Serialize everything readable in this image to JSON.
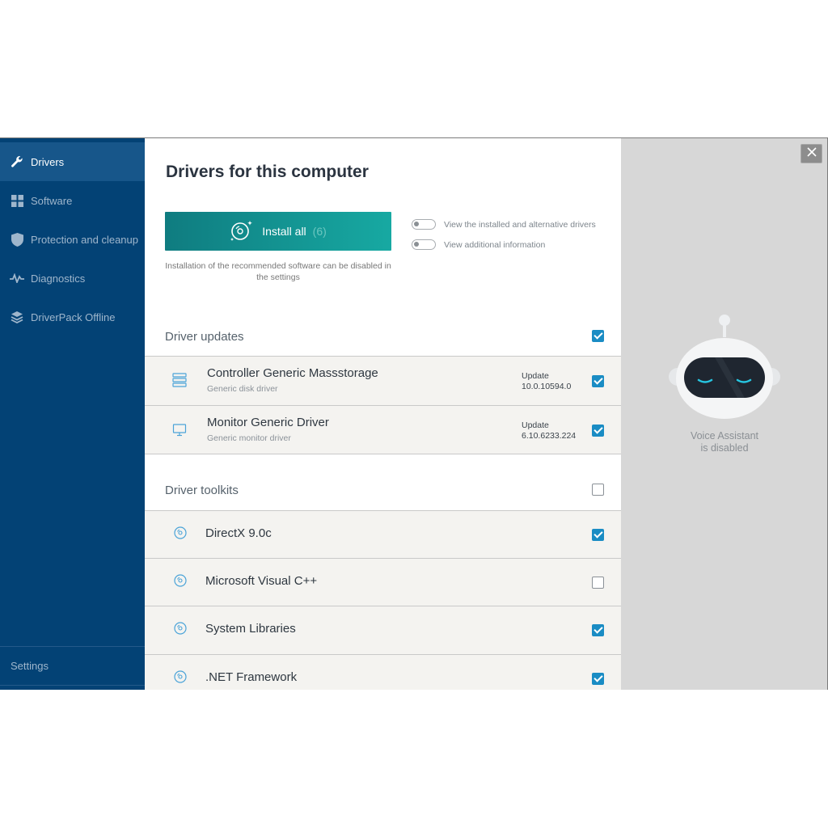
{
  "sidebar": {
    "items": [
      {
        "label": "Drivers",
        "icon": "wrench-icon",
        "active": true
      },
      {
        "label": "Software",
        "icon": "grid-icon",
        "active": false
      },
      {
        "label": "Protection and cleanup",
        "icon": "shield-icon",
        "active": false
      },
      {
        "label": "Diagnostics",
        "icon": "pulse-icon",
        "active": false
      },
      {
        "label": "DriverPack Offline",
        "icon": "layers-icon",
        "active": false
      }
    ],
    "settings_label": "Settings"
  },
  "main": {
    "title": "Drivers for this computer",
    "install_label": "Install all",
    "install_count": "(6)",
    "install_note": "Installation of the recommended software can be disabled in the settings",
    "toggles": [
      {
        "label": "View the installed and alternative drivers",
        "on": false
      },
      {
        "label": "View additional information",
        "on": false
      }
    ],
    "driver_updates": {
      "title": "Driver updates",
      "checked": true,
      "items": [
        {
          "name": "Controller Generic Massstorage",
          "sub": "Generic disk driver",
          "update_label": "Update",
          "version": "10.0.10594.0",
          "icon": "storage-icon",
          "checked": true
        },
        {
          "name": "Monitor Generic Driver",
          "sub": "Generic monitor driver",
          "update_label": "Update",
          "version": "6.10.6233.224",
          "icon": "monitor-icon",
          "checked": true
        }
      ]
    },
    "driver_toolkits": {
      "title": "Driver toolkits",
      "checked": false,
      "items": [
        {
          "name": "DirectX 9.0c",
          "icon": "disc-icon",
          "checked": true
        },
        {
          "name": "Microsoft Visual C++",
          "icon": "disc-icon",
          "checked": false
        },
        {
          "name": "System Libraries",
          "icon": "disc-icon",
          "checked": true
        },
        {
          "name": ".NET Framework",
          "icon": "disc-icon",
          "checked": true
        }
      ]
    }
  },
  "assistant": {
    "status_line1": "Voice Assistant",
    "status_line2": "is disabled"
  },
  "colors": {
    "sidebar_bg": "#034275",
    "sidebar_active": "#17568a",
    "accent_teal": "#17a9a2",
    "checkbox_blue": "#1a8cc4",
    "assistant_bg": "#d7d7d7"
  }
}
